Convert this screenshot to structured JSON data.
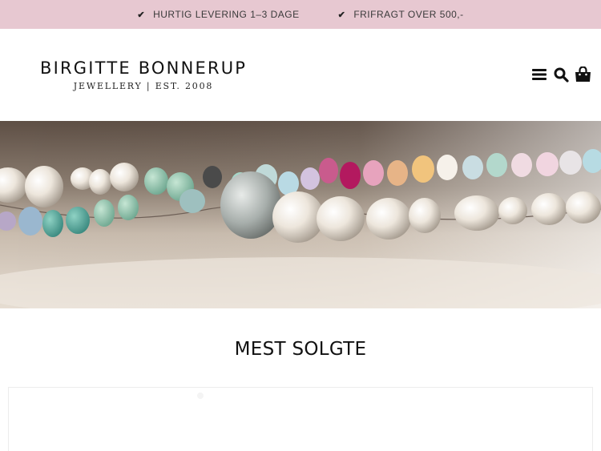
{
  "topbar": {
    "usps": [
      {
        "icon": "check-icon",
        "label": "HURTIG LEVERING 1–3 DAGE"
      },
      {
        "icon": "check-icon",
        "label": "FRIFRAGT OVER 500,-"
      }
    ],
    "background": "#e7c8d1"
  },
  "header": {
    "logo_name": "BIRGITTE BONNERUP",
    "logo_tagline": "JEWELLERY | EST. 2008",
    "icons": [
      "menu-icon",
      "search-icon",
      "shopping-bag-icon"
    ]
  },
  "hero": {
    "image": "pearl-and-gemstone-necklace-banner"
  },
  "bestsellers": {
    "title": "MEST SOLGTE"
  }
}
